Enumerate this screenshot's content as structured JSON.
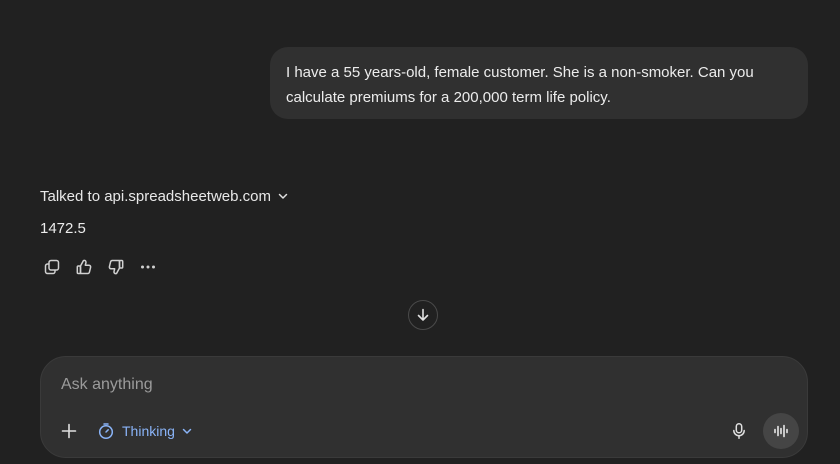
{
  "conversation": {
    "user_message": "I have a 55 years-old, female customer. She is a non-smoker. Can you calculate premiums for a 200,000 term life policy.",
    "tool_call_label": "Talked to api.spreadsheetweb.com",
    "assistant_answer": "1472.5"
  },
  "message_actions": [
    {
      "name": "copy",
      "icon": "copy-icon"
    },
    {
      "name": "thumbs-up",
      "icon": "thumbs-up-icon"
    },
    {
      "name": "thumbs-down",
      "icon": "thumbs-down-icon"
    },
    {
      "name": "more",
      "icon": "more-icon"
    }
  ],
  "composer": {
    "placeholder": "Ask anything",
    "value": "",
    "mode_label": "Thinking"
  },
  "colors": {
    "background": "#212121",
    "bubble": "#303030",
    "accent": "#8ab4f8",
    "text": "#ececec"
  }
}
